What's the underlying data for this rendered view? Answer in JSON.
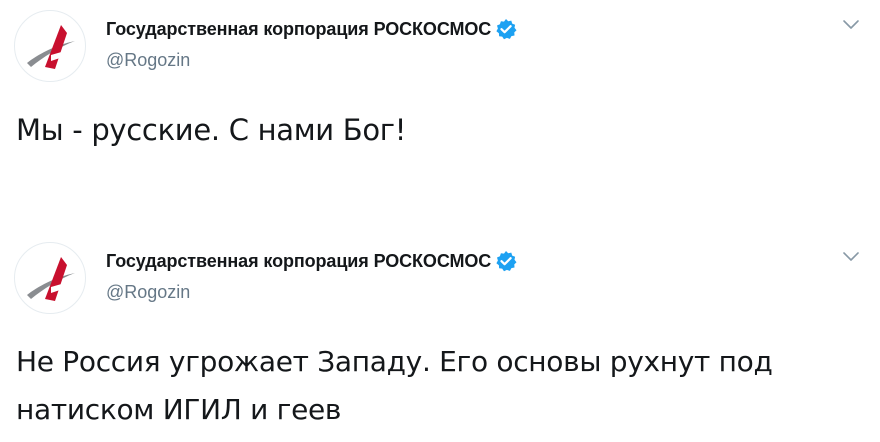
{
  "tweets": [
    {
      "display_name": "Государственная корпорация РОСКОСМОС",
      "handle": "@Rogozin",
      "verified": true,
      "text": "Мы - русские. С нами Бог!",
      "avatar_icon": "roscosmos-logo-icon",
      "menu_icon": "chevron-down-icon"
    },
    {
      "display_name": "Государственная корпорация РОСКОСМОС",
      "handle": "@Rogozin",
      "verified": true,
      "text": "Не Россия угрожает Западу. Его основы рухнут под натиском ИГИЛ и геев",
      "avatar_icon": "roscosmos-logo-icon",
      "menu_icon": "chevron-down-icon"
    }
  ],
  "colors": {
    "text_primary": "#14171a",
    "text_secondary": "#657786",
    "verified_blue": "#1da1f2",
    "logo_red": "#c8102e",
    "logo_gray": "#8a8d91"
  }
}
